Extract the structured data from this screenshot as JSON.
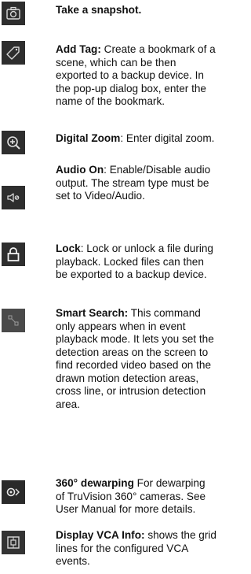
{
  "items": [
    {
      "icon": "camera-snapshot-icon",
      "term": "Take a snapshot.",
      "desc": ""
    },
    {
      "icon": "tag-icon",
      "term": "Add Tag:",
      "desc": " Create a bookmark of a scene, which can be then exported to a backup device. In the pop-up dialog box, enter the name of the bookmark."
    },
    {
      "icon": "zoom-in-icon",
      "term": "Digital Zoom",
      "desc": ": Enter digital zoom."
    },
    {
      "icon": "speaker-icon",
      "term": "Audio On",
      "desc": ": Enable/Disable audio output. The stream type must be set to Video/Audio."
    },
    {
      "icon": "lock-icon",
      "term": "Lock",
      "desc": ": Lock or unlock a file during playback. Locked files can then be exported to a backup device."
    },
    {
      "icon": "smart-search-icon",
      "term": "Smart Search:",
      "desc": " This command only appears when in event playback mode. It lets you set the detection areas on the screen to find recorded video based on the drawn motion detection areas, cross line, or intrusion detection area."
    },
    {
      "icon": "dewarping-360-icon",
      "term": "360° dewarping",
      "desc": " For dewarping of TruVision 360° cameras. See User Manual for more details."
    },
    {
      "icon": "vca-info-icon",
      "term": "Display VCA Info:",
      "desc": " shows the grid lines for the configured VCA events."
    }
  ]
}
